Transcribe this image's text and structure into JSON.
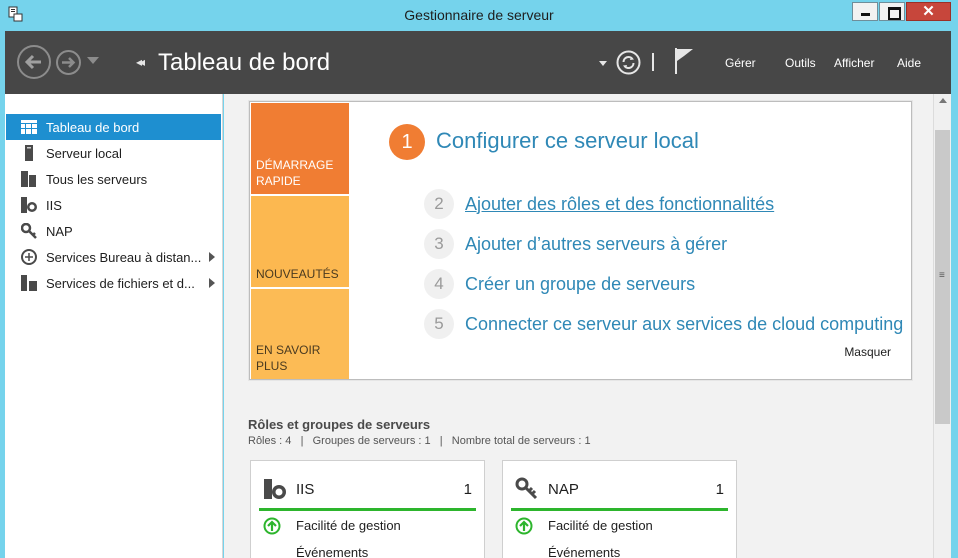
{
  "window": {
    "title": "Gestionnaire de serveur",
    "close_glyph": "✕"
  },
  "header": {
    "breadcrumb_arrows": "◂◂",
    "page_title": "Tableau de bord",
    "menu": [
      "Gérer",
      "Outils",
      "Afficher",
      "Aide"
    ]
  },
  "sidebar": {
    "items": [
      {
        "label": "Tableau de bord",
        "icon": "dashboard-icon",
        "active": true
      },
      {
        "label": "Serveur local",
        "icon": "local-server-icon"
      },
      {
        "label": "Tous les serveurs",
        "icon": "all-servers-icon"
      },
      {
        "label": "IIS",
        "icon": "iis-icon"
      },
      {
        "label": "NAP",
        "icon": "nap-icon"
      },
      {
        "label": "Services Bureau à distan...",
        "icon": "remote-desktop-icon",
        "expandable": true
      },
      {
        "label": "Services de fichiers et d...",
        "icon": "file-services-icon",
        "expandable": true
      }
    ]
  },
  "quick_start": {
    "tabs": [
      "DÉMARRAGE RAPIDE",
      "NOUVEAUTÉS",
      "EN SAVOIR PLUS"
    ],
    "step1": {
      "num": "1",
      "text": "Configurer ce serveur local"
    },
    "steps": [
      {
        "num": "2",
        "text": "Ajouter des rôles et des fonctionnalités"
      },
      {
        "num": "3",
        "text": "Ajouter d’autres serveurs à gérer"
      },
      {
        "num": "4",
        "text": "Créer un groupe de serveurs"
      },
      {
        "num": "5",
        "text": "Connecter ce serveur aux services de cloud computing"
      }
    ],
    "hide": "Masquer"
  },
  "roles_groups": {
    "title": "Rôles et groupes de serveurs",
    "subtitle": "Rôles : 4   |   Groupes de serveurs : 1   |   Nombre total de serveurs : 1"
  },
  "tiles": [
    {
      "name": "IIS",
      "count": "1",
      "status": "Facilité de gestion",
      "row2": "Événements",
      "icon": "iis-icon"
    },
    {
      "name": "NAP",
      "count": "1",
      "status": "Facilité de gestion",
      "row2": "Événements",
      "icon": "nap-icon"
    }
  ],
  "colors": {
    "accent_blue": "#1e8fd0",
    "header_bg": "#474747",
    "orange": "#f07d33",
    "status_green": "#2db52d"
  }
}
